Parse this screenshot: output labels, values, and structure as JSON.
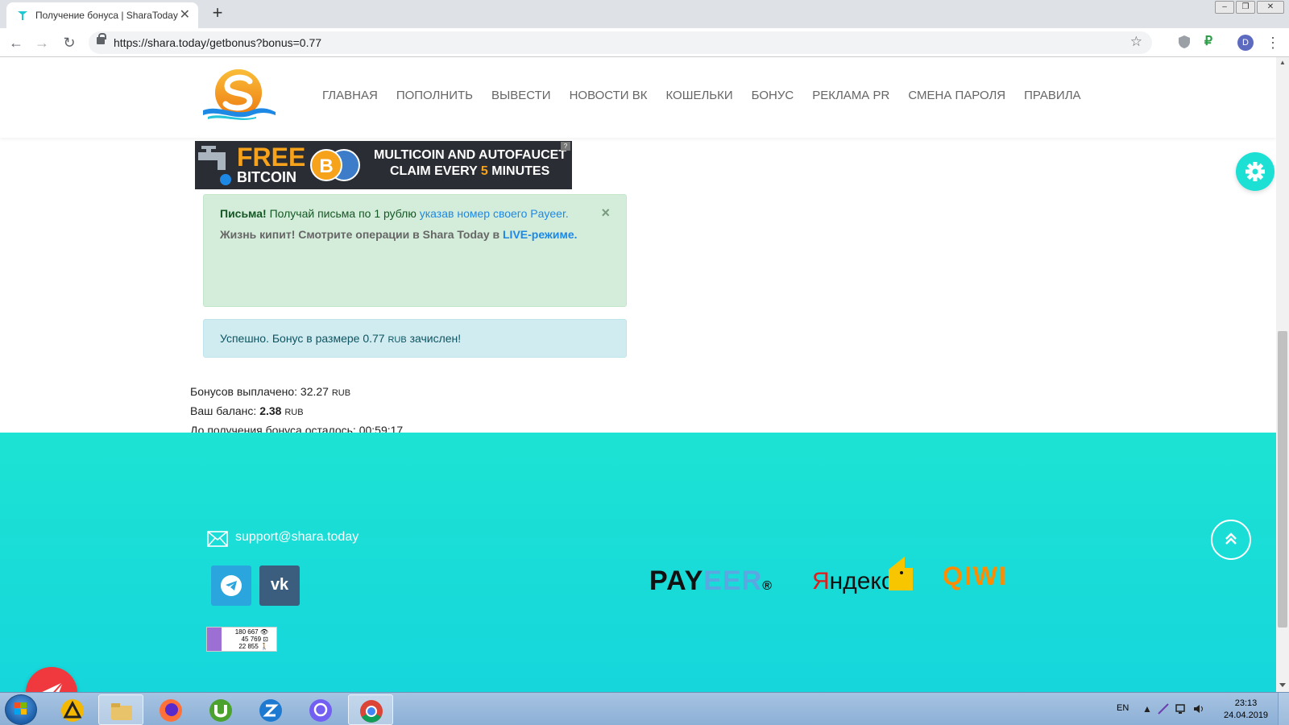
{
  "browser": {
    "tab_title": "Получение бонуса | SharaToday",
    "tab_close": "✕",
    "new_tab": "+",
    "url": "https://shara.today/getbonus?bonus=0.77",
    "profile_initial": "D",
    "window_controls": {
      "minimize": "‒",
      "restore": "❐",
      "close": "✕"
    },
    "nav": {
      "back": "←",
      "forward": "→",
      "reload": "↻",
      "star": "☆",
      "menu": "⋮"
    },
    "ext_ruble": "₽"
  },
  "site": {
    "menu": [
      "ГЛАВНАЯ",
      "ПОПОЛНИТЬ",
      "ВЫВЕСТИ",
      "НОВОСТИ ВК",
      "КОШЕЛЬКИ",
      "БОНУС",
      "РЕКЛАМА PR",
      "СМЕНА ПАРОЛЯ",
      "ПРАВИЛА"
    ],
    "banner": {
      "free": "FREE",
      "bitcoin": "BITCOIN",
      "coin": "B",
      "line1": "MULTICOIN AND AUTOFAUCET",
      "line2_pre": "CLAIM EVERY ",
      "line2_num": "5",
      "line2_post": " MINUTES",
      "question": "?"
    },
    "alert_green": {
      "bold": "Письма!",
      "text": " Получай письма по 1 рублю ",
      "link": "указав номер своего Payeer.",
      "live_text": "Жизнь кипит! Смотрите операции в Shara Today в ",
      "live_link": "LIVE-режиме.",
      "close": "×"
    },
    "alert_blue": {
      "pre": "Успешно. Бонус в размере 0.77 ",
      "currency": "RUB",
      "post": " зачислен!"
    },
    "stats": {
      "paid_label": "Бонусов выплачено: 32.27 ",
      "paid_currency": "RUB",
      "balance_label": "Ваш баланс: ",
      "balance_value": "2.38",
      "balance_currency": "RUB",
      "timer_label": "До получения бонуса осталось: 00:59:17"
    },
    "footer": {
      "email": "support@shara.today",
      "vk": "vk",
      "counter": [
        "180 667 👁",
        "45 769 ⊡",
        "22 855 🚶"
      ],
      "payeer_1": "PAY",
      "payeer_2": "EER",
      "payeer_reg": "®",
      "yandex_ya": "Я",
      "yandex_rest": "ндекс",
      "qiwi": "QIWI"
    }
  },
  "taskbar": {
    "lang": "EN",
    "time": "23:13",
    "date": "24.04.2019",
    "tray_arrow": "▲"
  },
  "colors": {
    "accent_cyan": "#1de0d5",
    "alert_green_bg": "#d4edda",
    "alert_blue_bg": "#d1ecf1",
    "send_red": "#f0393e"
  }
}
